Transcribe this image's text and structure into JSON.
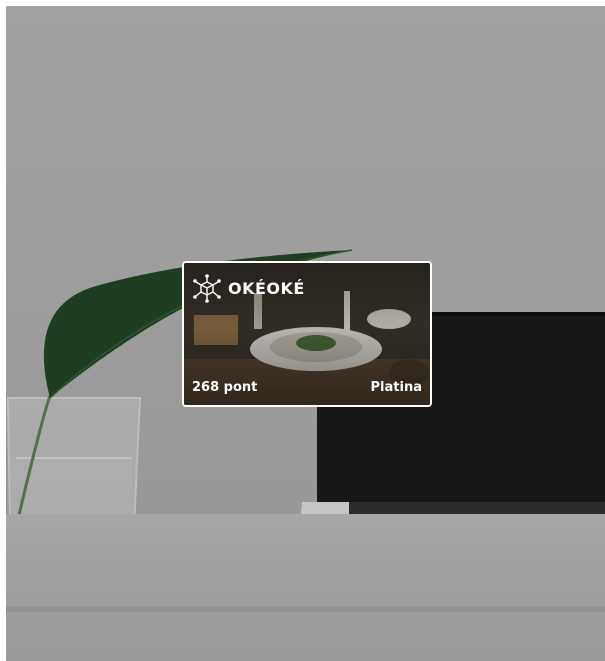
{
  "background": {
    "scene": "plant-and-laptop-photo",
    "overlay_color": "#000000"
  },
  "card": {
    "brand": "OKÉOKÉ",
    "logo_icon": "network-cube-icon",
    "points_label": "268 pont",
    "tier_label": "Platina",
    "border_color": "#ffffff"
  }
}
